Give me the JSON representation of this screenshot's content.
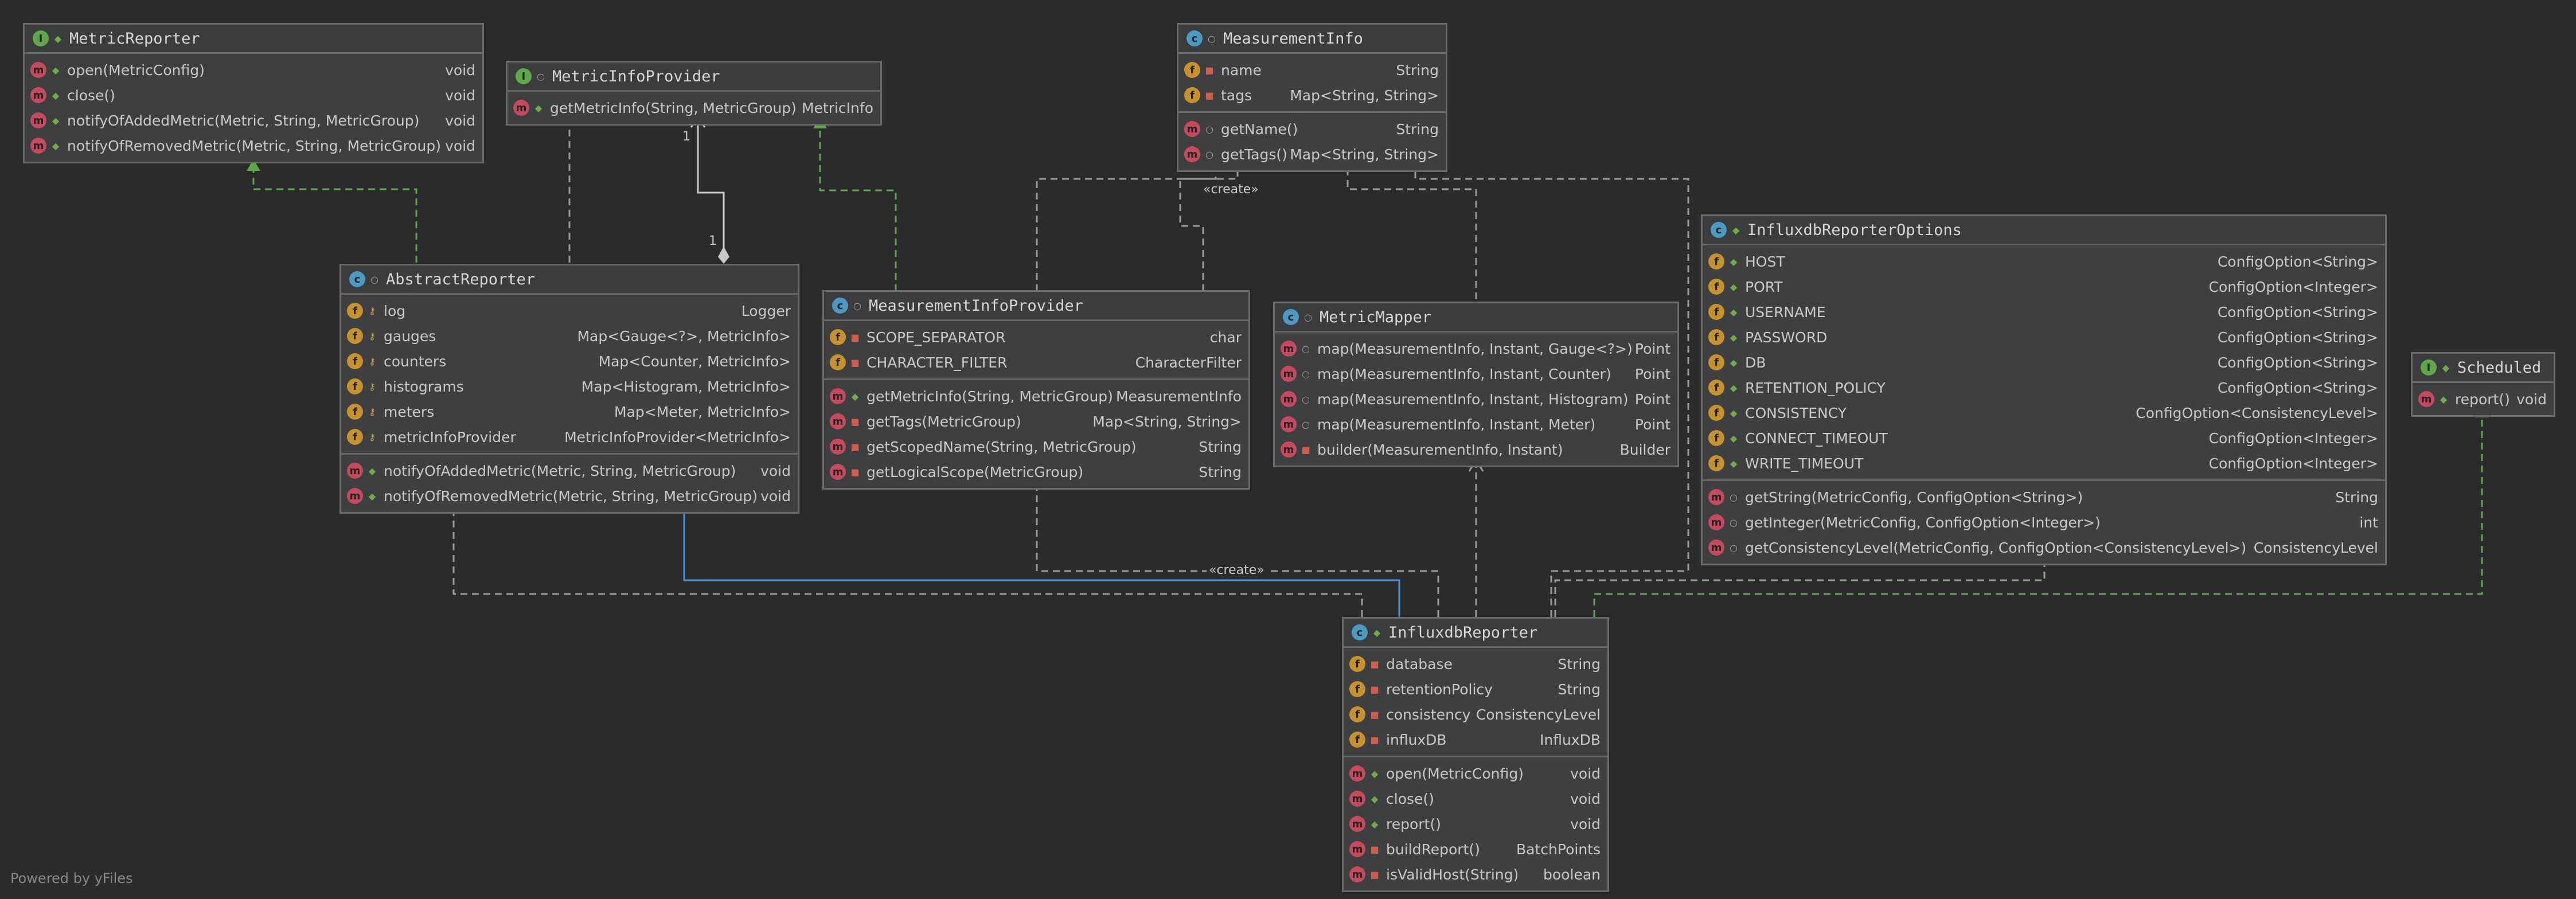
{
  "classes": {
    "metric_reporter": {
      "name": "MetricReporter",
      "kind": "interface",
      "methods": [
        {
          "name": "open(MetricConfig)",
          "type": "void"
        },
        {
          "name": "close()",
          "type": "void"
        },
        {
          "name": "notifyOfAddedMetric(Metric, String, MetricGroup)",
          "type": "void"
        },
        {
          "name": "notifyOfRemovedMetric(Metric, String, MetricGroup)",
          "type": "void"
        }
      ]
    },
    "metric_info_provider": {
      "name": "MetricInfoProvider",
      "kind": "interface",
      "methods": [
        {
          "name": "getMetricInfo(String, MetricGroup)",
          "type": "MetricInfo"
        }
      ]
    },
    "measurement_info": {
      "name": "MeasurementInfo",
      "kind": "class",
      "fields": [
        {
          "name": "name",
          "type": "String"
        },
        {
          "name": "tags",
          "type": "Map<String, String>"
        }
      ],
      "methods": [
        {
          "name": "getName()",
          "type": "String"
        },
        {
          "name": "getTags()",
          "type": "Map<String, String>"
        }
      ]
    },
    "abstract_reporter": {
      "name": "AbstractReporter",
      "kind": "abstract",
      "fields": [
        {
          "name": "log",
          "type": "Logger"
        },
        {
          "name": "gauges",
          "type": "Map<Gauge<?>, MetricInfo>"
        },
        {
          "name": "counters",
          "type": "Map<Counter, MetricInfo>"
        },
        {
          "name": "histograms",
          "type": "Map<Histogram, MetricInfo>"
        },
        {
          "name": "meters",
          "type": "Map<Meter, MetricInfo>"
        },
        {
          "name": "metricInfoProvider",
          "type": "MetricInfoProvider<MetricInfo>"
        }
      ],
      "methods": [
        {
          "name": "notifyOfAddedMetric(Metric, String, MetricGroup)",
          "type": "void"
        },
        {
          "name": "notifyOfRemovedMetric(Metric, String, MetricGroup)",
          "type": "void"
        }
      ]
    },
    "measurement_info_provider": {
      "name": "MeasurementInfoProvider",
      "kind": "class",
      "fields": [
        {
          "name": "SCOPE_SEPARATOR",
          "type": "char"
        },
        {
          "name": "CHARACTER_FILTER",
          "type": "CharacterFilter"
        }
      ],
      "methods": [
        {
          "name": "getMetricInfo(String, MetricGroup)",
          "type": "MeasurementInfo"
        },
        {
          "name": "getTags(MetricGroup)",
          "type": "Map<String, String>"
        },
        {
          "name": "getScopedName(String, MetricGroup)",
          "type": "String"
        },
        {
          "name": "getLogicalScope(MetricGroup)",
          "type": "String"
        }
      ]
    },
    "metric_mapper": {
      "name": "MetricMapper",
      "kind": "class",
      "methods": [
        {
          "name": "map(MeasurementInfo, Instant, Gauge<?>)",
          "type": "Point"
        },
        {
          "name": "map(MeasurementInfo, Instant, Counter)",
          "type": "Point"
        },
        {
          "name": "map(MeasurementInfo, Instant, Histogram)",
          "type": "Point"
        },
        {
          "name": "map(MeasurementInfo, Instant, Meter)",
          "type": "Point"
        },
        {
          "name": "builder(MeasurementInfo, Instant)",
          "type": "Builder"
        }
      ]
    },
    "influxdb_reporter_options": {
      "name": "InfluxdbReporterOptions",
      "kind": "class",
      "fields": [
        {
          "name": "HOST",
          "type": "ConfigOption<String>"
        },
        {
          "name": "PORT",
          "type": "ConfigOption<Integer>"
        },
        {
          "name": "USERNAME",
          "type": "ConfigOption<String>"
        },
        {
          "name": "PASSWORD",
          "type": "ConfigOption<String>"
        },
        {
          "name": "DB",
          "type": "ConfigOption<String>"
        },
        {
          "name": "RETENTION_POLICY",
          "type": "ConfigOption<String>"
        },
        {
          "name": "CONSISTENCY",
          "type": "ConfigOption<ConsistencyLevel>"
        },
        {
          "name": "CONNECT_TIMEOUT",
          "type": "ConfigOption<Integer>"
        },
        {
          "name": "WRITE_TIMEOUT",
          "type": "ConfigOption<Integer>"
        }
      ],
      "methods": [
        {
          "name": "getString(MetricConfig, ConfigOption<String>)",
          "type": "String"
        },
        {
          "name": "getInteger(MetricConfig, ConfigOption<Integer>)",
          "type": "int"
        },
        {
          "name": "getConsistencyLevel(MetricConfig, ConfigOption<ConsistencyLevel>)",
          "type": "ConsistencyLevel"
        }
      ]
    },
    "scheduled": {
      "name": "Scheduled",
      "kind": "interface",
      "methods": [
        {
          "name": "report()",
          "type": "void"
        }
      ]
    },
    "influxdb_reporter": {
      "name": "InfluxdbReporter",
      "kind": "class",
      "fields": [
        {
          "name": "database",
          "type": "String"
        },
        {
          "name": "retentionPolicy",
          "type": "String"
        },
        {
          "name": "consistency",
          "type": "ConsistencyLevel"
        },
        {
          "name": "influxDB",
          "type": "InfluxDB"
        }
      ],
      "methods": [
        {
          "name": "open(MetricConfig)",
          "type": "void"
        },
        {
          "name": "close()",
          "type": "void"
        },
        {
          "name": "report()",
          "type": "void"
        },
        {
          "name": "buildReport()",
          "type": "BatchPoints"
        },
        {
          "name": "isValidHost(String)",
          "type": "boolean"
        }
      ]
    }
  },
  "labels": {
    "create_1": "«create»",
    "create_2": "«create»",
    "mult_top": "1",
    "mult_bottom": "1"
  },
  "footer": "Powered by yFiles",
  "colors": {
    "background": "#2b2b2b",
    "edge": "#9a9a9a",
    "realization": "#5ea84a",
    "inheritance": "#4a8fe0"
  }
}
